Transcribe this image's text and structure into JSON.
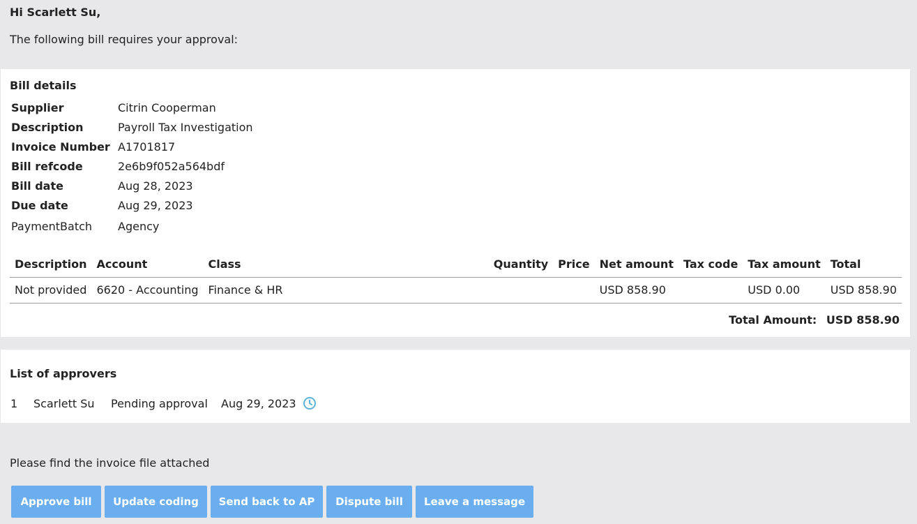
{
  "greeting": "Hi Scarlett Su,",
  "intro": "The following bill requires your approval:",
  "bill": {
    "title": "Bill details",
    "details": [
      {
        "label": "Supplier",
        "value": "Citrin Cooperman"
      },
      {
        "label": "Description",
        "value": "Payroll Tax Investigation"
      },
      {
        "label": "Invoice Number",
        "value": "A1701817"
      },
      {
        "label": "Bill refcode",
        "value": "2e6b9f052a564bdf"
      },
      {
        "label": "Bill date",
        "value": "Aug 28, 2023"
      },
      {
        "label": "Due date",
        "value": "Aug 29, 2023"
      },
      {
        "label": "PaymentBatch",
        "value": "Agency"
      }
    ],
    "columns": [
      "Description",
      "Account",
      "Class",
      "Quantity",
      "Price",
      "Net amount",
      "Tax code",
      "Tax amount",
      "Total"
    ],
    "rows": [
      {
        "description": "Not provided",
        "account": "6620 - Accounting",
        "class": "Finance & HR",
        "quantity": "",
        "price": "",
        "net_amount": "USD 858.90",
        "tax_code": "",
        "tax_amount": "USD 0.00",
        "total": "USD 858.90"
      }
    ],
    "total_label": "Total Amount:",
    "total_value": "USD 858.90"
  },
  "approvers": {
    "title": "List of approvers",
    "items": [
      {
        "index": "1",
        "name": "Scarlett Su",
        "status": "Pending approval",
        "date": "Aug 29, 2023",
        "icon": "clock-icon"
      }
    ]
  },
  "attachment_note": "Please find the invoice file attached",
  "actions": {
    "approve": "Approve bill",
    "update_coding": "Update coding",
    "send_back": "Send back to AP",
    "dispute": "Dispute bill",
    "message": "Leave a message"
  },
  "colors": {
    "background": "#e8e8ea",
    "panel": "#ffffff",
    "button": "#6aaef0",
    "icon": "#5bb3d8"
  }
}
